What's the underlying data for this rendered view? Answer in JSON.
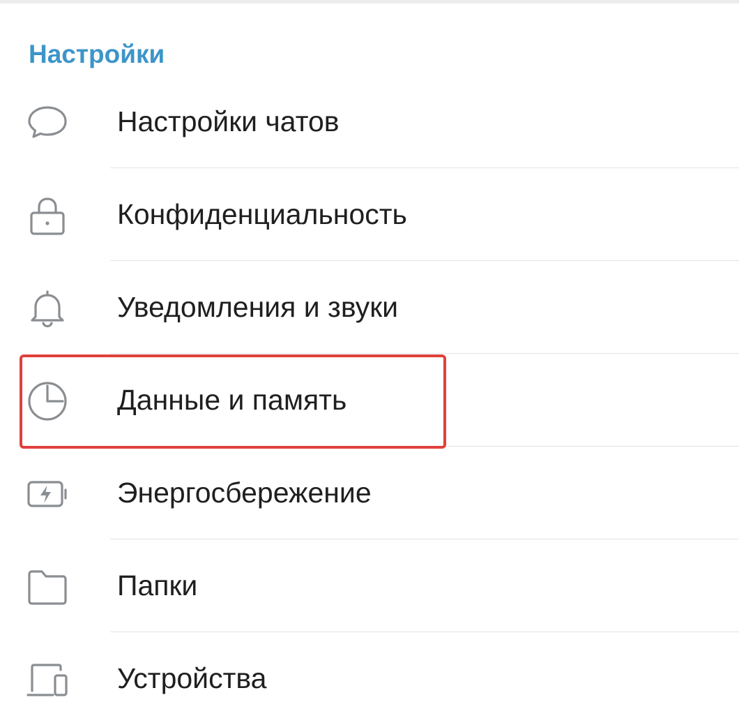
{
  "header": {
    "title": "Настройки"
  },
  "settings": {
    "items": [
      {
        "label": "Настройки чатов",
        "icon": "chat-bubble-icon"
      },
      {
        "label": "Конфиденциальность",
        "icon": "lock-icon"
      },
      {
        "label": "Уведомления и звуки",
        "icon": "bell-icon"
      },
      {
        "label": "Данные и память",
        "icon": "pie-chart-icon"
      },
      {
        "label": "Энергосбережение",
        "icon": "battery-bolt-icon"
      },
      {
        "label": "Папки",
        "icon": "folder-icon"
      },
      {
        "label": "Устройства",
        "icon": "devices-icon"
      }
    ]
  },
  "highlight": {
    "target": "Данные и память",
    "color": "#e0403b"
  },
  "colors": {
    "accent": "#3d95c9",
    "icon": "#8a8d91",
    "text": "#1f1f1f"
  }
}
